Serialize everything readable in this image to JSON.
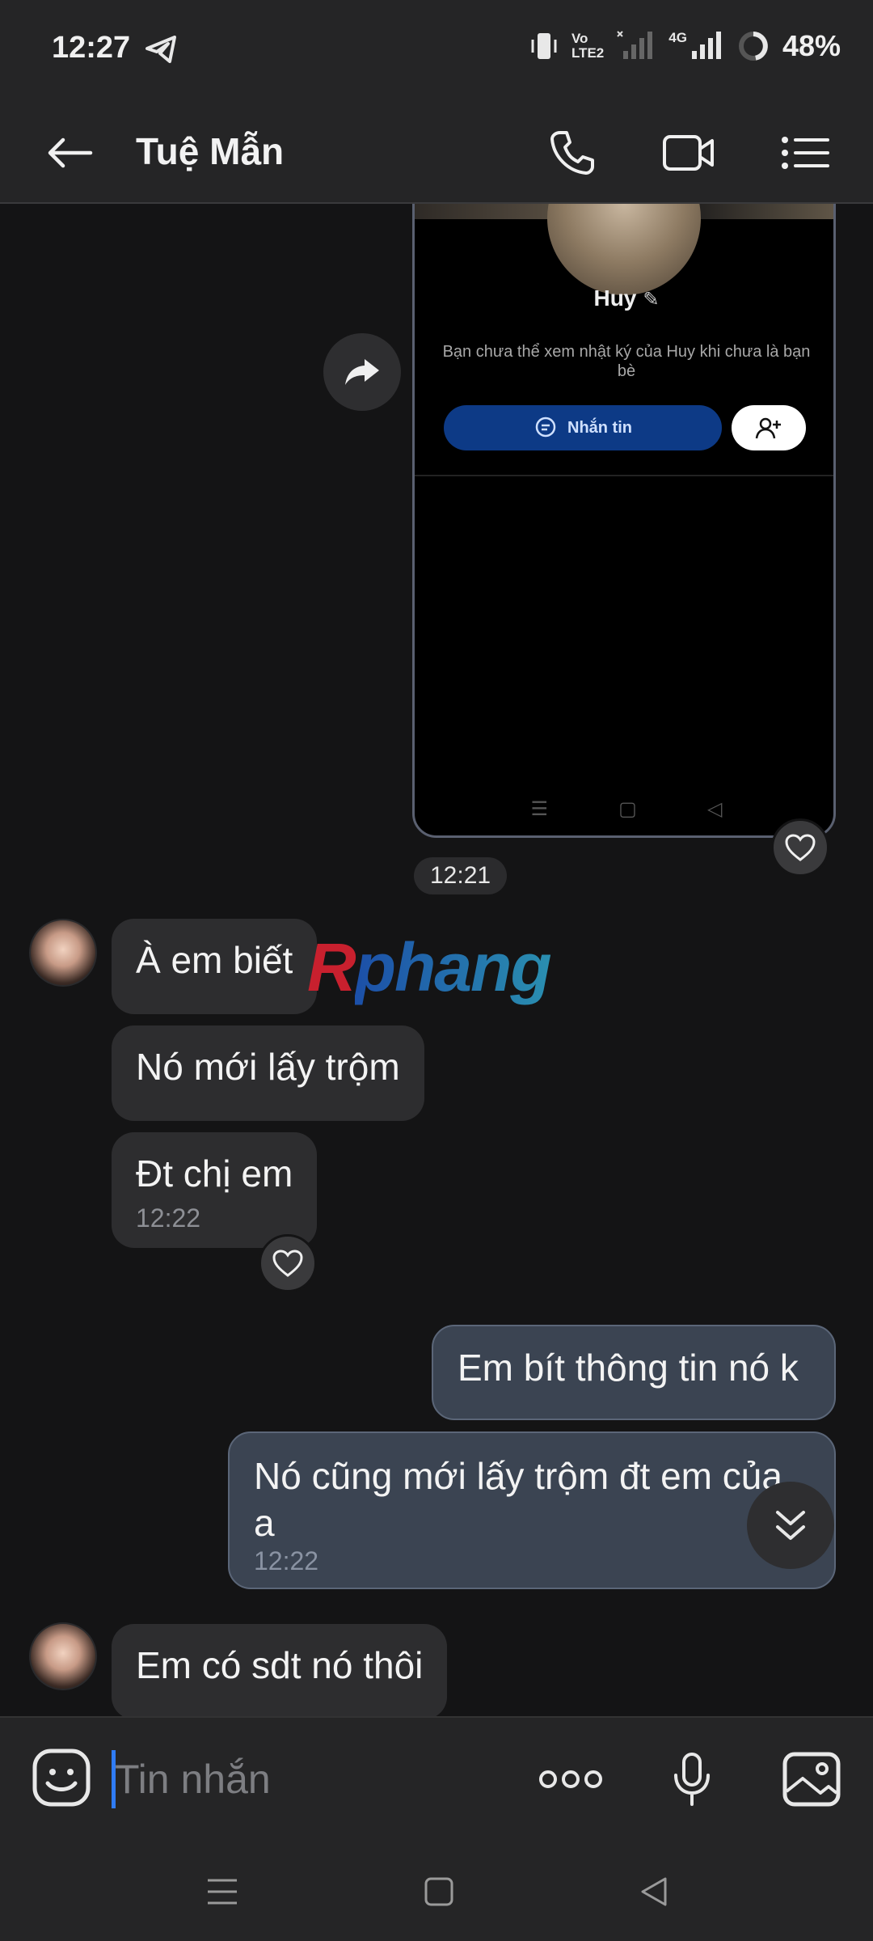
{
  "status_bar": {
    "time": "12:27",
    "battery": "48%",
    "network_labels": [
      "Vo",
      "LTE2",
      "4G"
    ]
  },
  "header": {
    "title": "Tuệ Mẫn",
    "icons": [
      "back-arrow-icon",
      "phone-icon",
      "video-camera-icon",
      "menu-list-icon"
    ]
  },
  "shared_screenshot": {
    "profile_name": "Huy",
    "note": "Bạn chưa thể xem nhật ký của Huy khi chưa là bạn bè",
    "message_button": "Nhắn tin"
  },
  "watermark": {
    "first": "R",
    "rest": "phang"
  },
  "time_divider": "12:21",
  "messages": [
    {
      "side": "in",
      "text": "À em biết"
    },
    {
      "side": "in",
      "text": "Nó mới lấy trộm"
    },
    {
      "side": "in",
      "text": "Đt chị em",
      "time": "12:22"
    },
    {
      "side": "out",
      "text": "Em bít thông tin nó k"
    },
    {
      "side": "out",
      "text": "Nó cũng mới lấy trộm đt em của a",
      "time": "12:22"
    },
    {
      "side": "in",
      "text": "Em có sdt nó thôi"
    }
  ],
  "input": {
    "placeholder": "Tin nhắn"
  },
  "colors": {
    "background": "#141415",
    "bar": "#252526",
    "incoming_bubble": "#2d2d2f",
    "outgoing_bubble": "#3b4452",
    "caret": "#2f7cf6"
  }
}
